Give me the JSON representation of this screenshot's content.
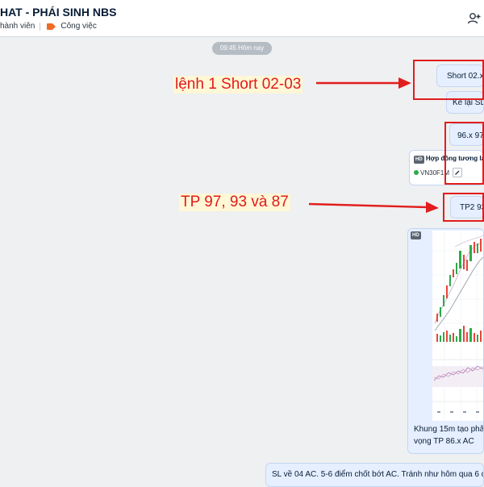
{
  "header": {
    "title": "HAT - PHÁI SINH NBS",
    "members_label": "hành viên",
    "tag_label": "Công việc",
    "add_member_icon": "add-member-icon"
  },
  "timestamp": "09:45 Hôm nay",
  "messages": {
    "short": "Short 02.x-",
    "sl": "Kè lại SL (",
    "price": "96.x 97",
    "card_title": "Hợp đồng tương lai VN3",
    "card_code": "VN30F1M",
    "card_badge": "HD",
    "tp": "TP2 93",
    "image_badge": "HD",
    "caption_line1": "Khung 15m tạo phân",
    "caption_line2": "vọng TP 86.x AC",
    "bottom": "SL về 04 AC. 5-6 điểm chốt bớt AC. Tránh như hôm qua 6 điể"
  },
  "annotations": {
    "label1": "lệnh 1 Short 02-03",
    "label2": "TP 97, 93 và 87",
    "color": "#e21d1d"
  },
  "colors": {
    "bubble_bg": "#e5efff",
    "chat_bg": "#eef0f1",
    "accent_tag": "#f06a28"
  }
}
